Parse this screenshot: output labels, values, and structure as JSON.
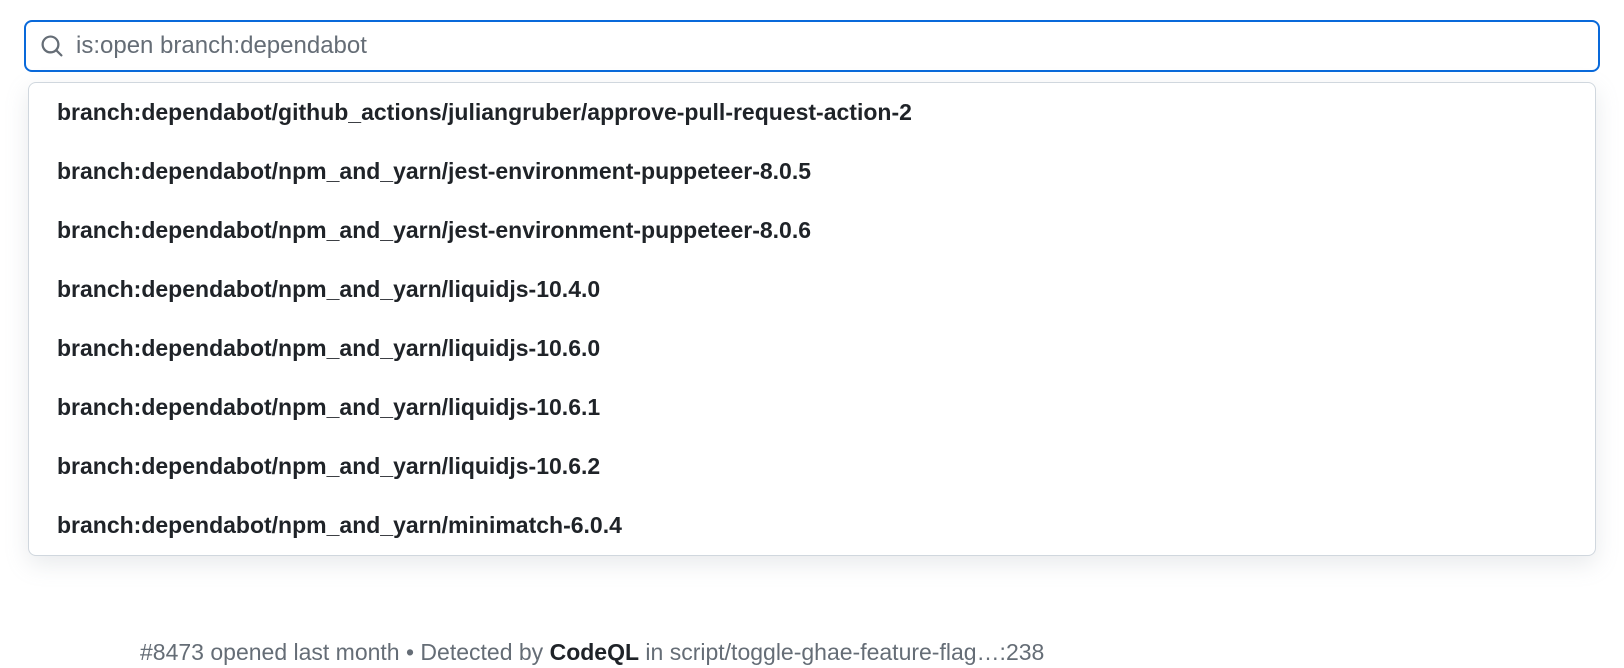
{
  "search": {
    "value": "is:open branch:dependabot",
    "placeholder": ""
  },
  "suggestions": [
    "branch:dependabot/github_actions/juliangruber/approve-pull-request-action-2",
    "branch:dependabot/npm_and_yarn/jest-environment-puppeteer-8.0.5",
    "branch:dependabot/npm_and_yarn/jest-environment-puppeteer-8.0.6",
    "branch:dependabot/npm_and_yarn/liquidjs-10.4.0",
    "branch:dependabot/npm_and_yarn/liquidjs-10.6.0",
    "branch:dependabot/npm_and_yarn/liquidjs-10.6.1",
    "branch:dependabot/npm_and_yarn/liquidjs-10.6.2",
    "branch:dependabot/npm_and_yarn/minimatch-6.0.4"
  ],
  "background_row": {
    "issue_ref": "#8473",
    "opened_text": " opened last month • Detected by ",
    "detector": "CodeQL",
    "path_text": " in script/toggle-ghae-feature-flag…:238"
  }
}
